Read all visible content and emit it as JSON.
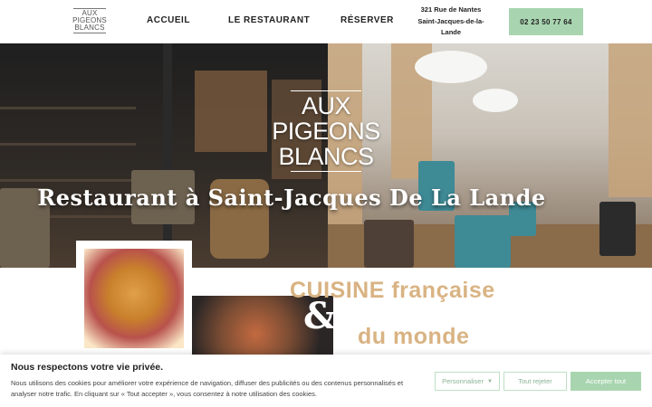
{
  "brand": {
    "logo_line1": "AUX",
    "logo_line2": "PIGEONS",
    "logo_line3": "BLANCS"
  },
  "nav": {
    "items": [
      {
        "label": "ACCUEIL"
      },
      {
        "label": "LE RESTAURANT"
      },
      {
        "label": "RÉSERVER"
      }
    ],
    "address_line1": "321 Rue de Nantes",
    "address_line2": "Saint-Jacques-de-la-",
    "address_line3": "Lande",
    "phone": "02 23 50 77 64"
  },
  "hero": {
    "logo_line1": "AUX",
    "logo_line2": "PIGEONS",
    "logo_line3": "BLANCS",
    "title": "Restaurant à Saint-Jacques De La Lande"
  },
  "intro": {
    "line1": "CUISINE française",
    "amp": "&",
    "line2": "du monde"
  },
  "cookie": {
    "title": "Nous respectons votre vie privée.",
    "text": "Nous utilisons des cookies pour améliorer votre expérience de navigation, diffuser des publicités ou des contenus personnalisés et analyser notre trafic. En cliquant sur « Tout accepter », vous consentez à notre utilisation des cookies.",
    "customize_label": "Personnaliser",
    "reject_label": "Tout rejeter",
    "accept_label": "Accepter tout"
  },
  "colors": {
    "accent_green": "#a8d5b0",
    "gold_text": "#d9b383"
  }
}
